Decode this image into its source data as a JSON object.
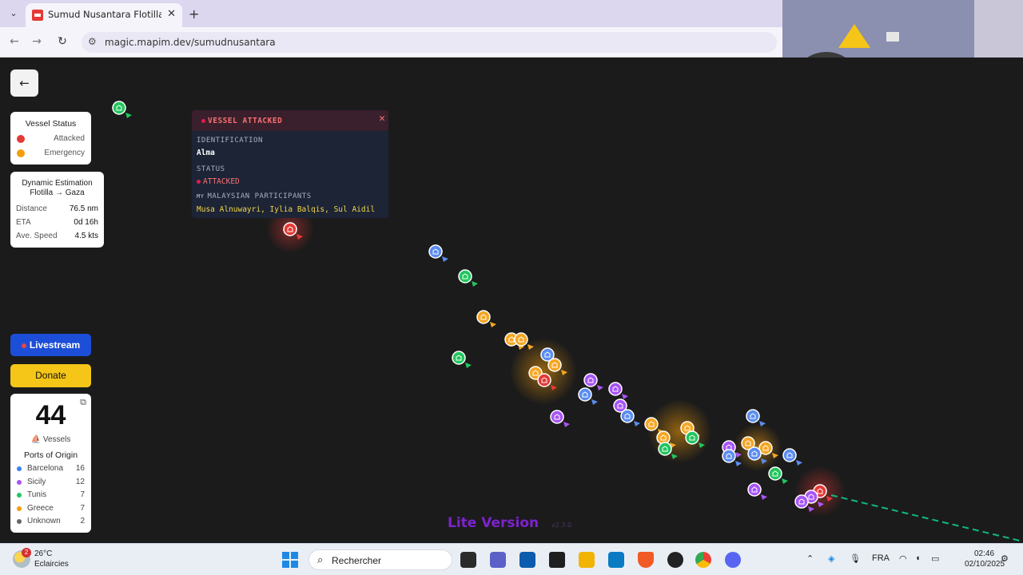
{
  "browser": {
    "tab_title": "Sumud Nusantara Flotilla Tracker",
    "url": "magic.mapim.dev/sumudnusantara"
  },
  "back_button": "←",
  "legend": {
    "title": "Vessel Status",
    "items": [
      {
        "label": "Attacked",
        "color": "#e53935"
      },
      {
        "label": "Emergency",
        "color": "#f59e0b"
      }
    ]
  },
  "estimation": {
    "title": "Dynamic Estimation Flotilla → Gaza",
    "rows": [
      {
        "label": "Distance",
        "value": "76.5 nm"
      },
      {
        "label": "ETA",
        "value": "0d 16h"
      },
      {
        "label": "Ave. Speed",
        "value": "4.5 kts"
      }
    ]
  },
  "buttons": {
    "livestream": "Livestream",
    "donate": "Donate"
  },
  "vessels": {
    "count": "44",
    "label": "Vessels",
    "ports_title": "Ports of Origin",
    "ports": [
      {
        "name": "Barcelona",
        "count": "16",
        "color": "#3b82f6"
      },
      {
        "name": "Sicily",
        "count": "12",
        "color": "#a855f7"
      },
      {
        "name": "Tunis",
        "count": "7",
        "color": "#22c55e"
      },
      {
        "name": "Greece",
        "count": "7",
        "color": "#f59e0b"
      },
      {
        "name": "Unknown",
        "count": "2",
        "color": "#666666"
      }
    ]
  },
  "popup": {
    "title": "VESSEL ATTACKED",
    "identification_label": "IDENTIFICATION",
    "identification_value": "Alma",
    "status_label": "STATUS",
    "status_value": "ATTACKED",
    "participants_flag": "MY",
    "participants_label": "MALAYSIAN PARTICIPANTS",
    "participants": "Musa Alnuwayri, Iylia Balqis, Sul Aidil"
  },
  "footer": {
    "lite": "Lite Version",
    "version": "v2.3.0"
  },
  "taskbar": {
    "temp": "26°C",
    "weather": "Eclaircies",
    "weather_badge": "2",
    "search": "Rechercher",
    "lang": "FRA",
    "time": "02:46",
    "date": "02/10/2025"
  }
}
